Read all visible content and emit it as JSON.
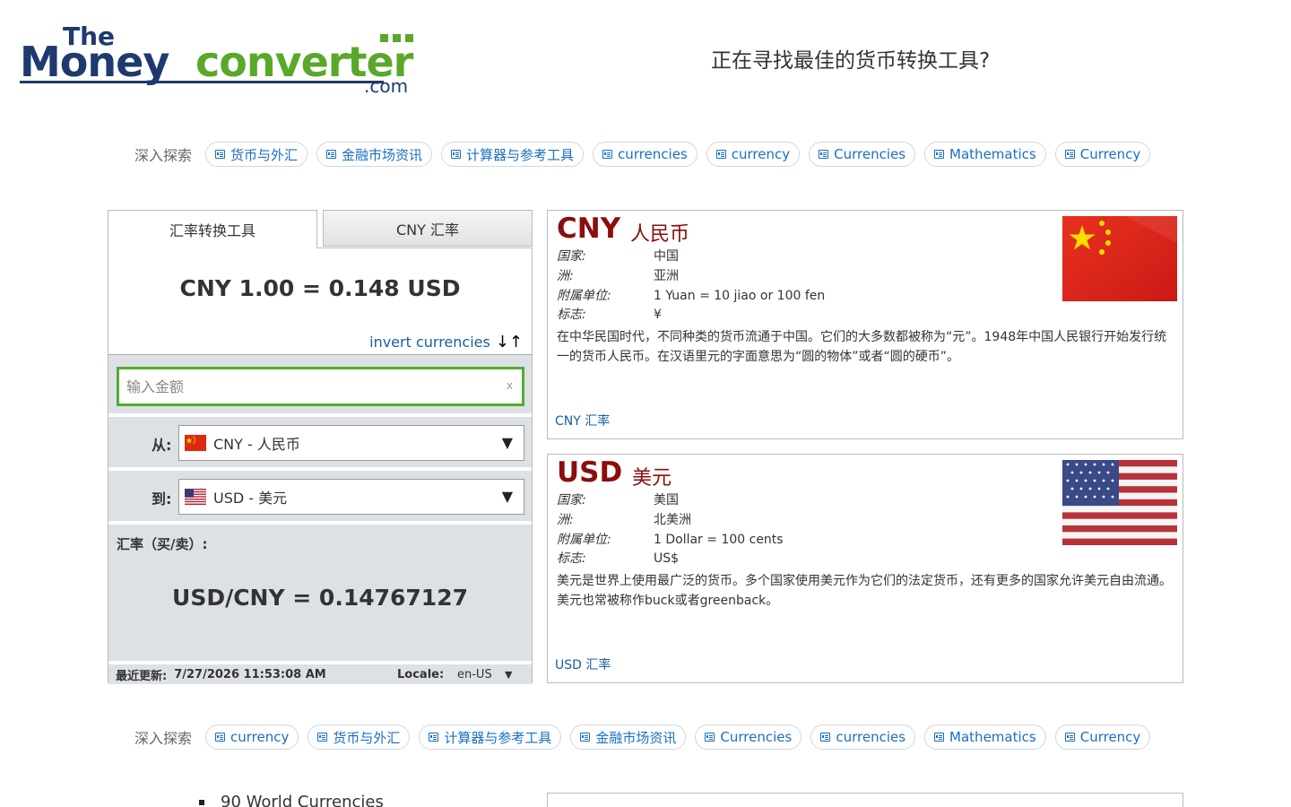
{
  "header": {
    "logo_the": "The",
    "logo_money": "Money",
    "logo_converter": "converter",
    "logo_com": ".com",
    "tagline": "正在寻找最佳的货币转换工具?"
  },
  "explore_top": {
    "label": "深入探索",
    "chips": [
      "货币与外汇",
      "金融市场资讯",
      "计算器与参考工具",
      "currencies",
      "currency",
      "Currencies",
      "Mathematics",
      "Currency"
    ]
  },
  "explore_bottom": {
    "label": "深入探索",
    "chips": [
      "currency",
      "货币与外汇",
      "计算器与参考工具",
      "金融市场资讯",
      "Currencies",
      "currencies",
      "Mathematics",
      "Currency"
    ]
  },
  "converter": {
    "tab_active": "汇率转换工具",
    "tab_inactive": "CNY 汇率",
    "result": "CNY 1.00 = 0.148 USD",
    "invert_label": "invert currencies",
    "invert_arrows": "↓↑",
    "amount_placeholder": "输入金额",
    "clear": "x",
    "from_label": "从:",
    "from_value": "CNY - 人民币",
    "to_label": "到:",
    "to_value": "USD - 美元",
    "caret": "▼",
    "rate_label": "汇率（买/卖）:",
    "rate_value": "USD/CNY = 0.14767127",
    "updated_label": "最近更新:",
    "updated_value": "7/27/2026 11:53:08 AM",
    "locale_label": "Locale:",
    "locale_value": "en-US",
    "locale_caret": "▼"
  },
  "cny_card": {
    "code": "CNY",
    "name": "人民币",
    "country_k": "国家:",
    "country_v": "中国",
    "continent_k": "洲:",
    "continent_v": "亚洲",
    "subunit_k": "附属单位:",
    "subunit_v": "1 Yuan = 10 jiao or 100 fen",
    "symbol_k": "标志:",
    "symbol_v": "¥",
    "desc": "在中华民国时代，不同种类的货币流通于中国。它们的大多数都被称为“元”。1948年中国人民银行开始发行统一的货币人民币。在汉语里元的字面意思为“圆的物体”或者“圆的硬币”。",
    "link": "CNY 汇率"
  },
  "usd_card": {
    "code": "USD",
    "name": "美元",
    "country_k": "国家:",
    "country_v": "美国",
    "continent_k": "洲:",
    "continent_v": "北美洲",
    "subunit_k": "附属单位:",
    "subunit_v": "1 Dollar = 100 cents",
    "symbol_k": "标志:",
    "symbol_v": "US$",
    "desc": "美元是世界上使用最广泛的货币。多个国家使用美元作为它们的法定货币，还有更多的国家允许美元自由流通。美元也常被称作buck或者greenback。",
    "link": "USD 汇率"
  },
  "bottom": {
    "list_item": "90 World Currencies"
  },
  "colors": {
    "brand_navy": "#1e3a6e",
    "brand_green": "#5aa82a",
    "currency_red": "#8b0d0d",
    "link_blue": "#1a5fa0"
  }
}
